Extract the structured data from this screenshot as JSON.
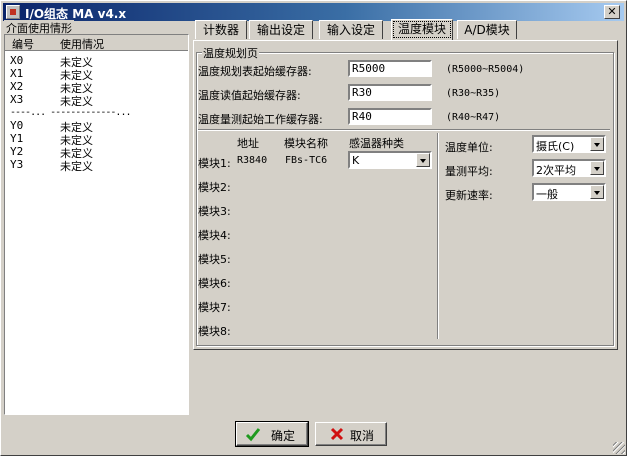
{
  "window": {
    "title": "I/O组态 MA v4.x",
    "close_glyph": "✕"
  },
  "left_panel": {
    "group_title": "介面使用情形",
    "col_id": "编号",
    "col_status": "使用情况",
    "inputs": [
      {
        "id": "X0",
        "status": "未定义"
      },
      {
        "id": "X1",
        "status": "未定义"
      },
      {
        "id": "X2",
        "status": "未定义"
      },
      {
        "id": "X3",
        "status": "未定义"
      }
    ],
    "separator": "----...  -------------...",
    "outputs": [
      {
        "id": "Y0",
        "status": "未定义"
      },
      {
        "id": "Y1",
        "status": "未定义"
      },
      {
        "id": "Y2",
        "status": "未定义"
      },
      {
        "id": "Y3",
        "status": "未定义"
      }
    ]
  },
  "tabs": [
    {
      "label": "计数器"
    },
    {
      "label": "输出设定"
    },
    {
      "label": "输入设定"
    },
    {
      "label": "温度模块"
    },
    {
      "label": "A/D模块"
    }
  ],
  "active_tab": "温度模块",
  "temp_page": {
    "group_title": "温度规划页",
    "rows": [
      {
        "label": "温度规划表起始缓存器:",
        "value": "R5000",
        "range": "(R5000~R5004)"
      },
      {
        "label": "温度读值起始缓存器:",
        "value": "R30",
        "range": "(R30~R35)"
      },
      {
        "label": "温度量测起始工作缓存器:",
        "value": "R40",
        "range": "(R40~R47)"
      }
    ],
    "col_address": "地址",
    "col_module_name": "模块名称",
    "col_sensor_type": "感温器种类",
    "modules": [
      {
        "label": "模块1:",
        "address": "R3840",
        "name": "FBs-TC6",
        "sensor": "K"
      },
      {
        "label": "模块2:"
      },
      {
        "label": "模块3:"
      },
      {
        "label": "模块4:"
      },
      {
        "label": "模块5:"
      },
      {
        "label": "模块6:"
      },
      {
        "label": "模块7:"
      },
      {
        "label": "模块8:"
      }
    ],
    "settings": [
      {
        "label": "温度单位:",
        "value": "摄氏(C)"
      },
      {
        "label": "量测平均:",
        "value": "2次平均"
      },
      {
        "label": "更新速率:",
        "value": "一般"
      }
    ]
  },
  "buttons": {
    "ok": "确定",
    "cancel": "取消"
  },
  "colors": {
    "title_start": "#0a246a",
    "title_end": "#a6caf0",
    "ok_check": "#1f9a1f",
    "cancel_x": "#d01010"
  }
}
